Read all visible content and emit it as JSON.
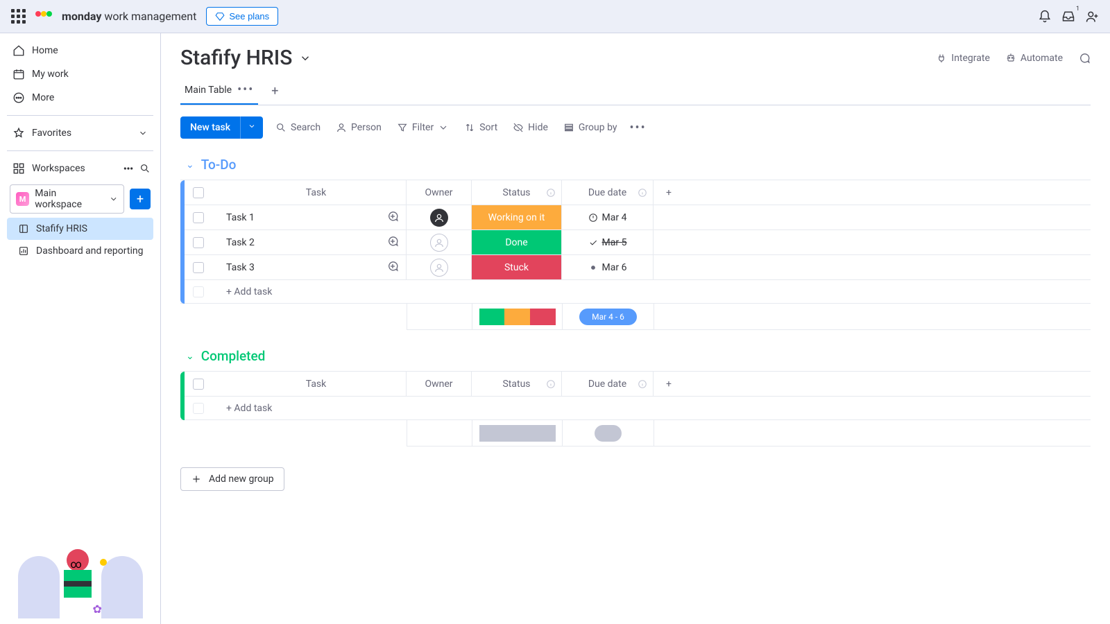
{
  "topbar": {
    "brand_bold": "monday",
    "brand_rest": " work management",
    "see_plans": "See plans",
    "inbox_badge": "1"
  },
  "sidebar": {
    "home": "Home",
    "mywork": "My work",
    "more": "More",
    "favorites": "Favorites",
    "workspaces": "Workspaces",
    "main_ws_badge": "M",
    "main_ws": "Main workspace",
    "boards": {
      "stafify": "Stafify HRIS",
      "dashboard": "Dashboard and reporting"
    }
  },
  "board": {
    "title": "Stafify HRIS",
    "integrate": "Integrate",
    "automate": "Automate",
    "tabs": {
      "main": "Main Table"
    },
    "toolbar": {
      "new_task": "New task",
      "search": "Search",
      "person": "Person",
      "filter": "Filter",
      "sort": "Sort",
      "hide": "Hide",
      "groupby": "Group by"
    },
    "columns": {
      "task": "Task",
      "owner": "Owner",
      "status": "Status",
      "due": "Due date"
    },
    "add_task": "+ Add task",
    "add_group": "Add new group",
    "summary_date": "Mar 4 - 6",
    "summary_date_empty": "-"
  },
  "groups": {
    "todo": {
      "name": "To-Do",
      "rows": [
        {
          "task": "Task 1",
          "status": "Working on it",
          "status_class": "status-working",
          "date": "Mar 4",
          "owner": "filled",
          "ind": "alert"
        },
        {
          "task": "Task 2",
          "status": "Done",
          "status_class": "status-done",
          "date": "Mar 5",
          "owner": "empty",
          "ind": "check",
          "strike": true
        },
        {
          "task": "Task 3",
          "status": "Stuck",
          "status_class": "status-stuck",
          "date": "Mar 6",
          "owner": "empty",
          "ind": "dot"
        }
      ]
    },
    "completed": {
      "name": "Completed",
      "rows": []
    }
  }
}
